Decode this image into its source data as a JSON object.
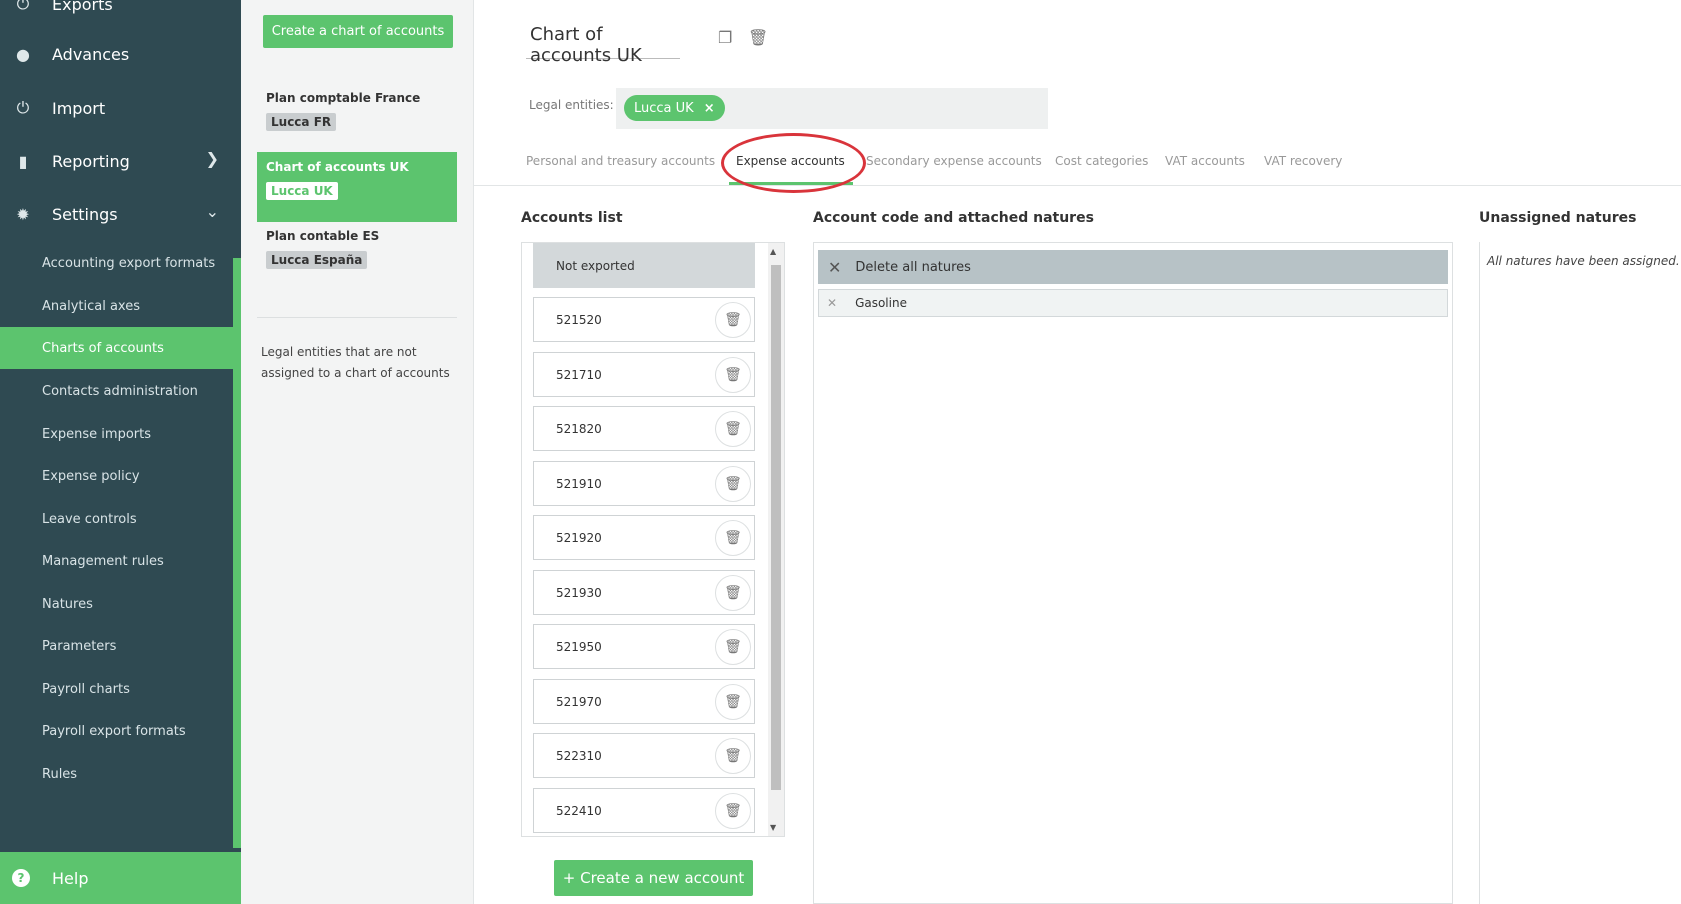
{
  "sidebar": {
    "exports_label": "Exports",
    "advances_label": "Advances",
    "import_label": "Import",
    "reporting_label": "Reporting",
    "settings_label": "Settings",
    "sub_items": [
      {
        "label": "Accounting export formats"
      },
      {
        "label": "Analytical axes"
      },
      {
        "label": "Charts of accounts"
      },
      {
        "label": "Contacts administration"
      },
      {
        "label": "Expense imports"
      },
      {
        "label": "Expense policy"
      },
      {
        "label": "Leave controls"
      },
      {
        "label": "Management rules"
      },
      {
        "label": "Natures"
      },
      {
        "label": "Parameters"
      },
      {
        "label": "Payroll charts"
      },
      {
        "label": "Payroll export formats"
      },
      {
        "label": "Rules"
      }
    ],
    "help_label": "Help"
  },
  "charts_panel": {
    "create_button": "Create a chart of accounts",
    "charts": [
      {
        "name": "Plan comptable France",
        "entity": "Lucca FR"
      },
      {
        "name": "Chart of accounts UK",
        "entity": "Lucca UK"
      },
      {
        "name": "Plan contable ES",
        "entity": "Lucca España"
      }
    ],
    "unassigned_note": "Legal entities that are not assigned to a chart of accounts"
  },
  "main": {
    "title": "Chart of accounts UK",
    "legal_entities_label": "Legal entities:",
    "legal_entity_pill": "Lucca UK",
    "tabs": [
      {
        "label": "Personal and treasury accounts"
      },
      {
        "label": "Expense accounts"
      },
      {
        "label": "Secondary expense accounts"
      },
      {
        "label": "Cost categories"
      },
      {
        "label": "VAT accounts"
      },
      {
        "label": "VAT recovery"
      }
    ],
    "accounts_list_title": "Accounts list",
    "accounts": [
      {
        "code": "Not exported"
      },
      {
        "code": "521520"
      },
      {
        "code": "521710"
      },
      {
        "code": "521820"
      },
      {
        "code": "521910"
      },
      {
        "code": "521920"
      },
      {
        "code": "521930"
      },
      {
        "code": "521950"
      },
      {
        "code": "521970"
      },
      {
        "code": "522310"
      },
      {
        "code": "522410"
      }
    ],
    "create_account_button": "+ Create a new account",
    "natures_title": "Account code and attached natures",
    "delete_all_label": "Delete all natures",
    "natures": [
      {
        "name": "Gasoline"
      }
    ],
    "unassigned_title": "Unassigned natures",
    "unassigned_message": "All natures have been assigned."
  },
  "colors": {
    "accent_green": "#5cc46e",
    "sidebar_bg": "#2f4a52",
    "highlight_red": "#d9343b"
  }
}
